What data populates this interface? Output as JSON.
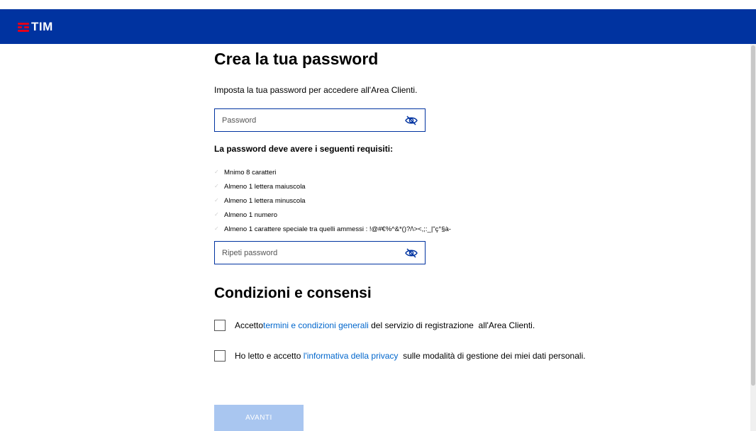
{
  "brand": {
    "logo_text": "TIM",
    "bar_color": "#0033a0",
    "logo_color": "#e2001a"
  },
  "form": {
    "title": "Crea la tua password",
    "subtitle": "Imposta la tua password per accedere all'Area Clienti.",
    "password_placeholder": "Password",
    "repeat_placeholder": "Ripeti password",
    "eye_icon": "eye-slash-icon",
    "requirements_title": "La password deve avere i seguenti requisiti:",
    "requirements": [
      "Mnimo 8 caratteri",
      "Almeno 1 lettera maiuscola",
      "Almeno 1 lettera minuscola",
      "Almeno 1 numero",
      "Almeno 1 carattere speciale tra quelli ammessi : !@#€%^&*()?/\\><,;:_|\"ç°§à-"
    ]
  },
  "consents": {
    "title": "Condizioni e consensi",
    "terms": {
      "prefix": "Accetto ",
      "link": "termini e condizioni generali",
      "suffix": " del servizio di registrazione  all'Area Clienti."
    },
    "privacy": {
      "prefix": "Ho letto e accetto ",
      "link": "l'informativa della privacy",
      "suffix": "  sulle modalità di gestione dei miei dati personali."
    }
  },
  "actions": {
    "next_label": "AVANTI",
    "next_color": "#a9c6f0"
  }
}
